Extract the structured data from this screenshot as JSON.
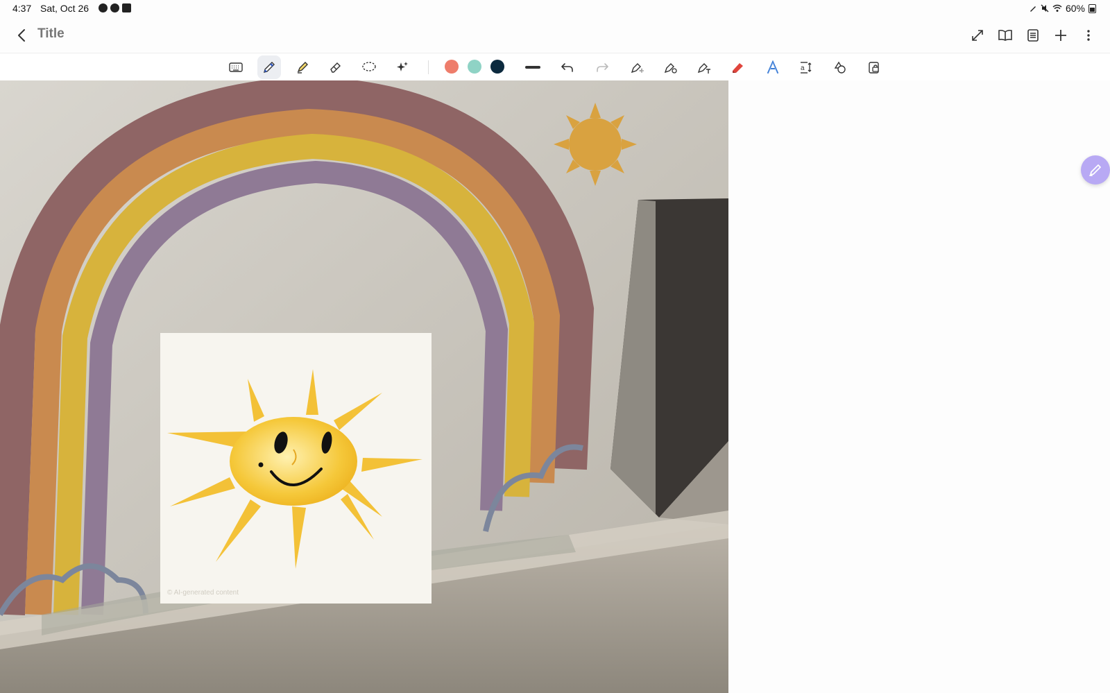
{
  "status": {
    "time": "4:37",
    "date": "Sat, Oct 26",
    "battery": "60%",
    "notification_icons": [
      "messenger-icon",
      "messenger-icon",
      "photos-icon"
    ],
    "system_icons": [
      "pen-connected-icon",
      "mute-icon",
      "wifi-icon",
      "battery-icon"
    ]
  },
  "header": {
    "title": "Title",
    "actions": [
      "expand-icon",
      "book-view-icon",
      "page-list-icon",
      "add-icon",
      "more-icon"
    ]
  },
  "toolbar": {
    "tools": [
      "keyboard",
      "pen",
      "highlighter",
      "eraser",
      "lasso",
      "ai-assist"
    ],
    "active_tool": "pen",
    "colors": [
      "#ee7d6b",
      "#8fd3c5",
      "#0c2a3e"
    ],
    "actions": [
      "stroke-width",
      "undo",
      "redo",
      "shape-pen",
      "pen-settings",
      "text-pen",
      "red-highlighter",
      "handwriting-to-text",
      "text-format",
      "shapes",
      "lock-layer"
    ]
  },
  "canvas": {
    "watermark": "© AI-generated content",
    "accent_fab": "#b8a9f4"
  }
}
